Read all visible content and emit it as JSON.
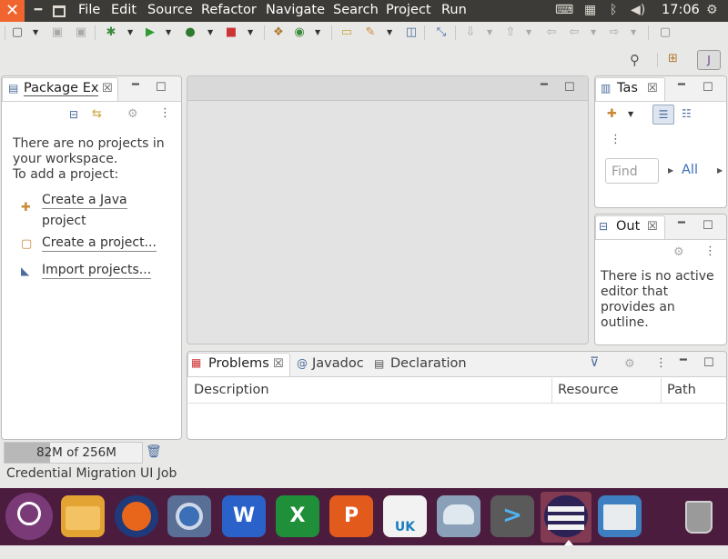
{
  "menubar": {
    "items": [
      "File",
      "Edit",
      "Source",
      "Refactor",
      "Navigate",
      "Search",
      "Project",
      "Run"
    ],
    "time": "17:06"
  },
  "package_explorer": {
    "tab_label": "Package Ex",
    "empty_line1": "There are no projects in",
    "empty_line2": "your workspace.",
    "empty_line3": "To add a project:",
    "link_java_1": "Create a Java",
    "link_java_2": "project",
    "link_project": "Create a project...",
    "link_import": "Import projects..."
  },
  "tasks": {
    "tab_label": "Tas",
    "find_placeholder": "Find",
    "all_label": "All"
  },
  "outline": {
    "tab_label": "Out",
    "msg1": "There is no active",
    "msg2": "editor that",
    "msg3": "provides an",
    "msg4": "outline."
  },
  "bottom": {
    "tabs": [
      "Problems",
      "Javadoc",
      "Declaration"
    ],
    "columns": [
      "Description",
      "Resource",
      "Path"
    ]
  },
  "status": {
    "heap": "82M of 256M",
    "job": "Credential Migration UI Job"
  },
  "colors": {
    "menubar": "#3c3b37",
    "dock": "#4c1c3e",
    "close": "#f0642f"
  }
}
